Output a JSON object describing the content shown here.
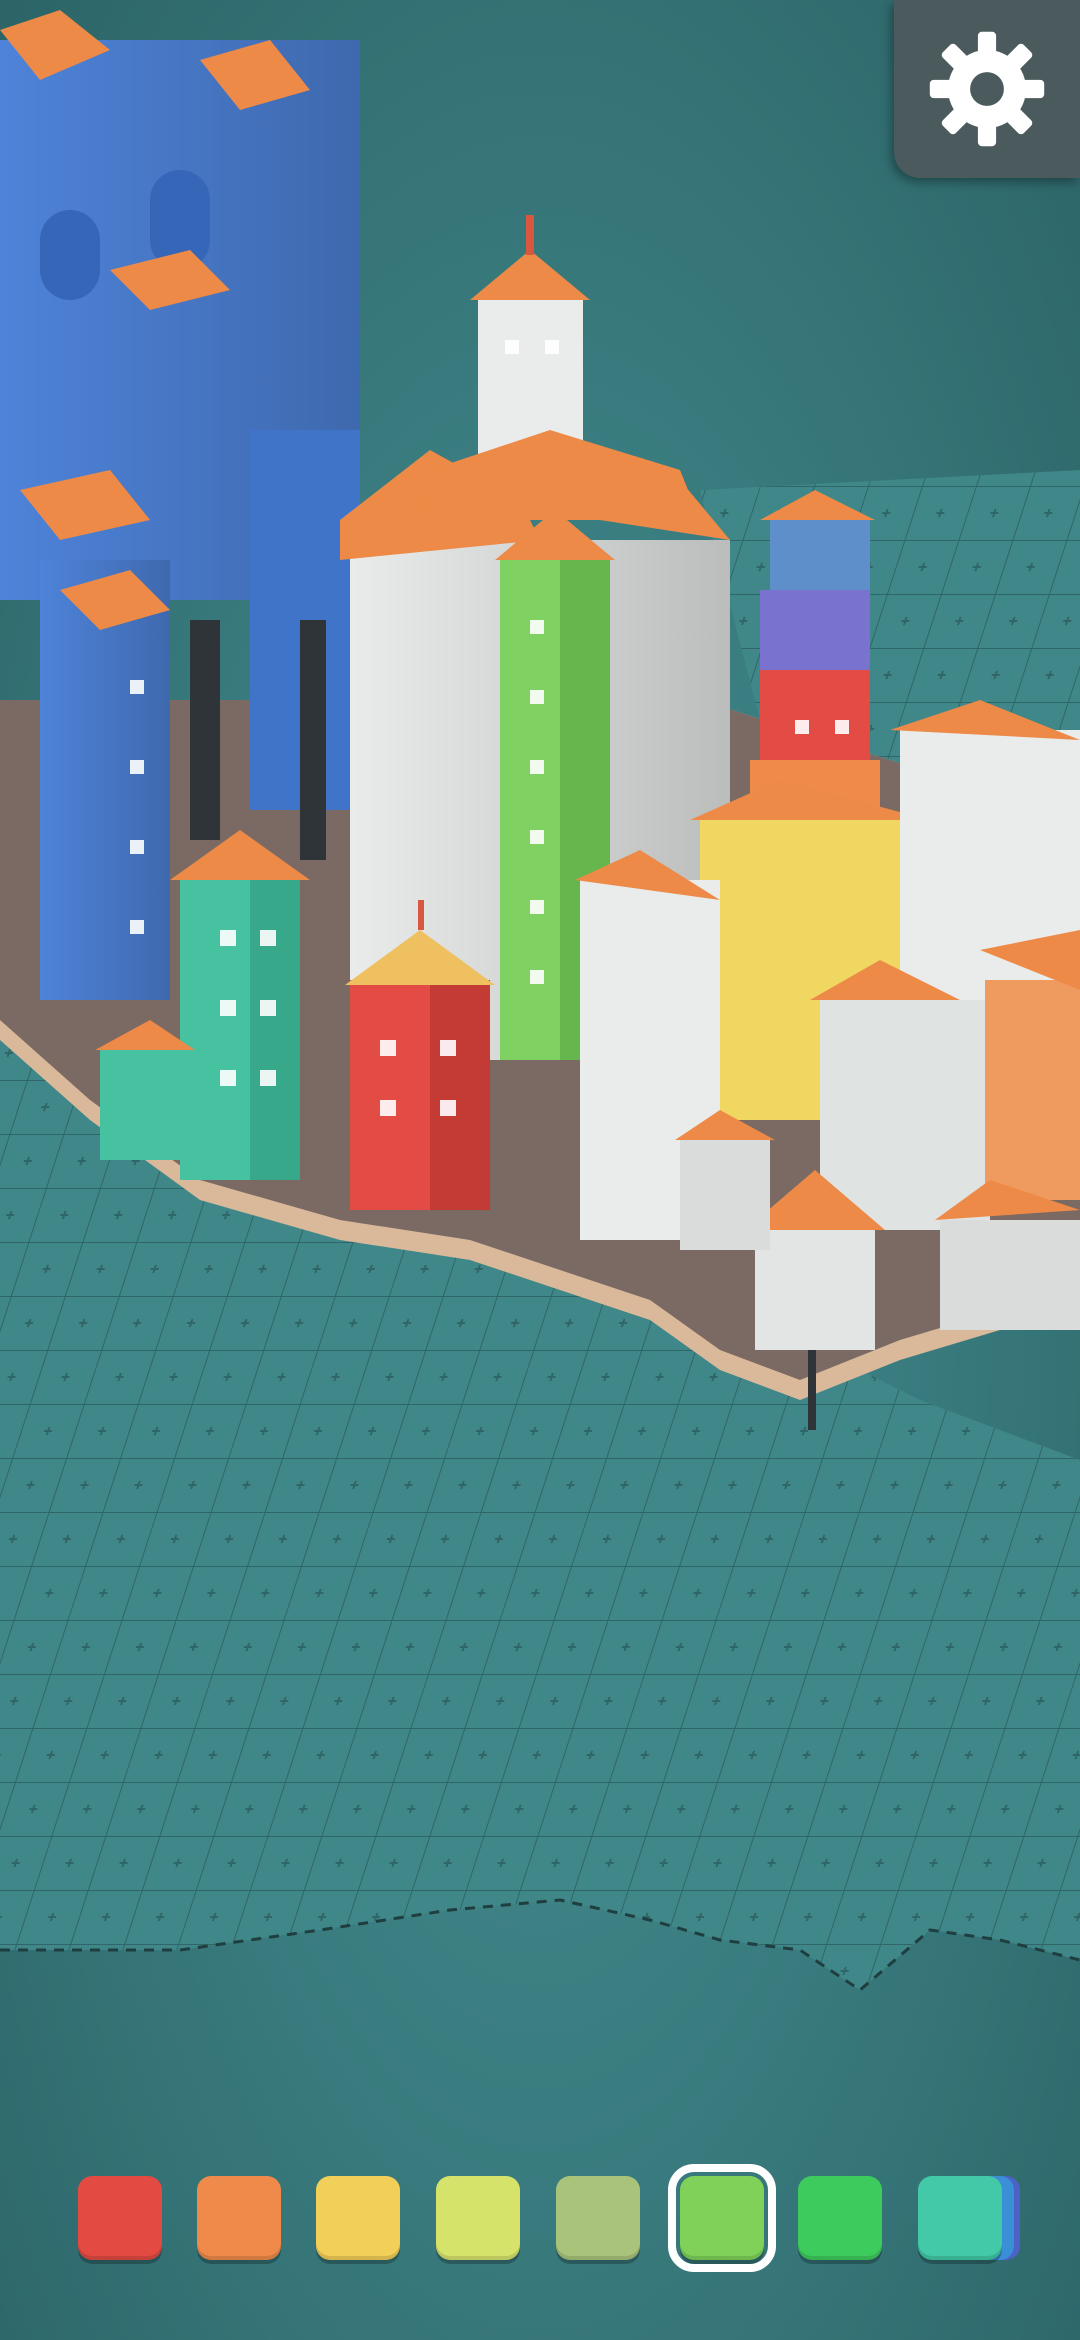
{
  "game": {
    "settings_icon": "gear-icon",
    "palette": [
      {
        "name": "red",
        "color": "#e24a42",
        "selected": false
      },
      {
        "name": "orange",
        "color": "#ef8a4a",
        "selected": false
      },
      {
        "name": "yellow",
        "color": "#f2cf58",
        "selected": false
      },
      {
        "name": "light-lime",
        "color": "#d6e36a",
        "selected": false
      },
      {
        "name": "olive-green",
        "color": "#a9c47a",
        "selected": false
      },
      {
        "name": "green",
        "color": "#7fd15a",
        "selected": true
      },
      {
        "name": "bright-green",
        "color": "#3ecb5e",
        "selected": false
      },
      {
        "name": "teal",
        "color": "#43c9a8",
        "selected": false
      }
    ],
    "extra_swatch_colors": [
      "#3b8fd6",
      "#4d62c7"
    ],
    "colors": {
      "water": "#3f8386",
      "grid_line": "#23484b",
      "roof": "#ee8a47",
      "wall_white": "#e9ecea",
      "wall_blue": "#4e83d9",
      "wall_green": "#7fd162",
      "wall_teal": "#46c2a0",
      "wall_red": "#e34c45",
      "wall_yellow": "#efd762",
      "ui_panel": "#4b5a5c"
    }
  }
}
